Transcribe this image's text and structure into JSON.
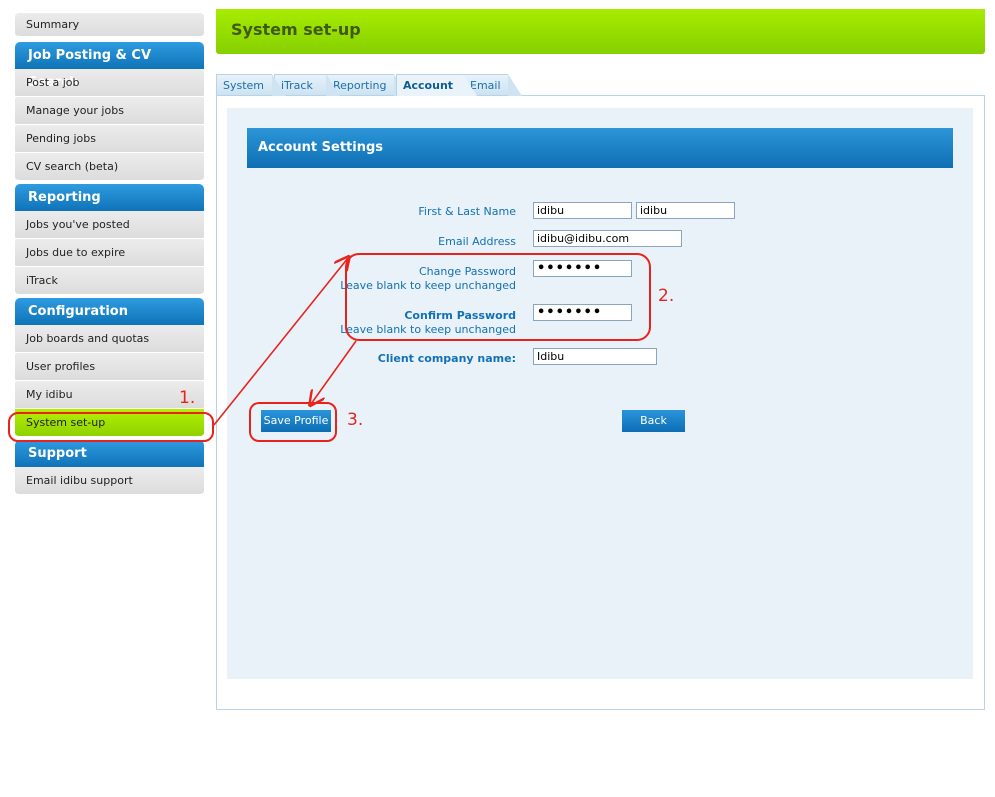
{
  "sidebar": {
    "summary": "Summary",
    "groups": [
      {
        "title": "Job Posting & CV Search",
        "items": [
          "Post a job",
          "Manage your jobs",
          "Pending jobs",
          "CV search (beta)"
        ]
      },
      {
        "title": "Reporting",
        "items": [
          "Jobs you've posted",
          "Jobs due to expire",
          "iTrack"
        ]
      },
      {
        "title": "Configuration",
        "items": [
          "Job boards and quotas",
          "User profiles",
          "My idibu",
          "System set-up"
        ]
      },
      {
        "title": "Support",
        "items": [
          "Email idibu support"
        ]
      }
    ],
    "active_item": "System set-up"
  },
  "header": {
    "title": "System set-up"
  },
  "tabs": [
    {
      "label": "System"
    },
    {
      "label": "iTrack"
    },
    {
      "label": "Reporting"
    },
    {
      "label": "Account",
      "active": true
    },
    {
      "label": "Email"
    }
  ],
  "section": {
    "title": "Account Settings"
  },
  "form": {
    "name_label": "First & Last Name",
    "first_name": "idibu",
    "last_name": "idibu",
    "email_label": "Email Address",
    "email": "idibu@idibu.com",
    "change_password_label": "Change Password",
    "change_password_hint": "Leave blank to keep unchanged",
    "change_password_value": "•••••••",
    "confirm_password_label": "Confirm Password",
    "confirm_password_hint": "Leave blank to keep unchanged",
    "confirm_password_value": "•••••••",
    "company_label": "Client company name:",
    "company": "Idibu"
  },
  "buttons": {
    "save": "Save Profile",
    "back": "Back"
  },
  "annotations": {
    "one": "1.",
    "two": "2.",
    "three": "3."
  },
  "colors": {
    "accent_green": "#8fd100",
    "accent_blue": "#0f73b8",
    "annotation_red": "#e8231d"
  }
}
